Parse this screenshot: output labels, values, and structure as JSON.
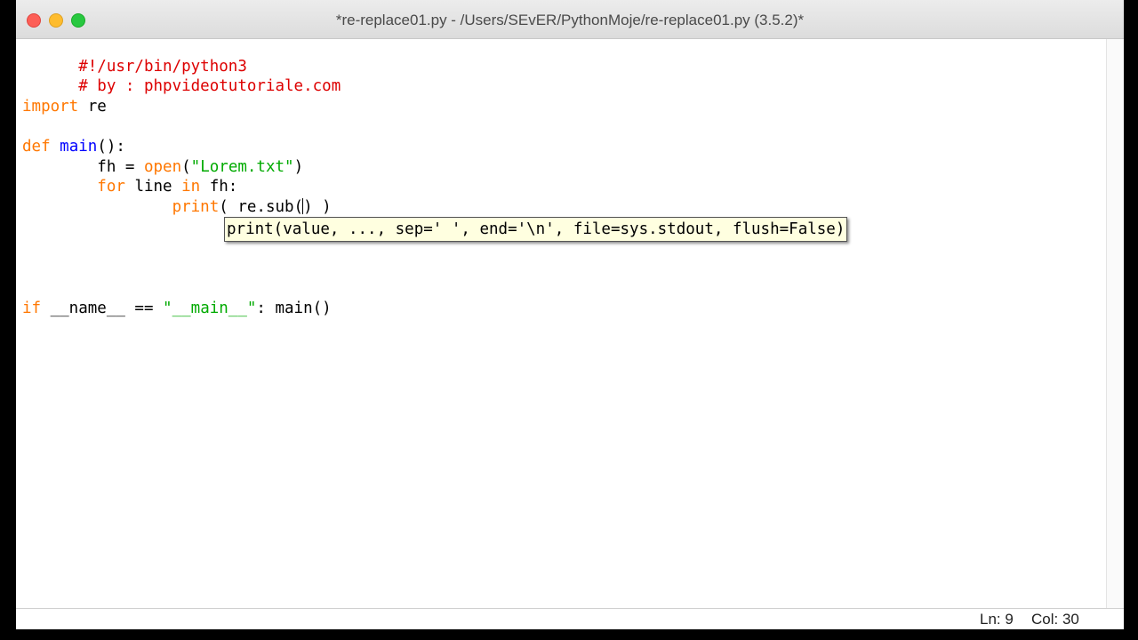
{
  "window": {
    "title": "*re-replace01.py - /Users/SEvER/PythonMoje/re-replace01.py (3.5.2)*"
  },
  "editor": {
    "line1": "#!/usr/bin/python3",
    "line2": "# by : phpvideotutoriale.com",
    "line4_kw": "import",
    "line4_rest": " re",
    "line6_kw": "def",
    "line6_name": "main",
    "line6_rest": "():",
    "line7_indent": "        fh = ",
    "line7_builtin": "open",
    "line7_paren": "(",
    "line7_str": "\"Lorem.txt\"",
    "line7_end": ")",
    "line8_indent": "        ",
    "line8_kw1": "for",
    "line8_mid": " line ",
    "line8_kw2": "in",
    "line8_end": " fh:",
    "line9_indent": "                ",
    "line9_builtin": "print",
    "line9_before_caret": "( re.sub(",
    "line9_after_caret": ") )",
    "line12_kw": "if",
    "line12_mid": " __name__ == ",
    "line12_str": "\"__main__\"",
    "line12_end": ": main()"
  },
  "calltip": {
    "text": "print(value, ..., sep=' ', end='\\n', file=sys.stdout, flush=False)"
  },
  "statusbar": {
    "line": "Ln: 9",
    "col": "Col: 30"
  }
}
